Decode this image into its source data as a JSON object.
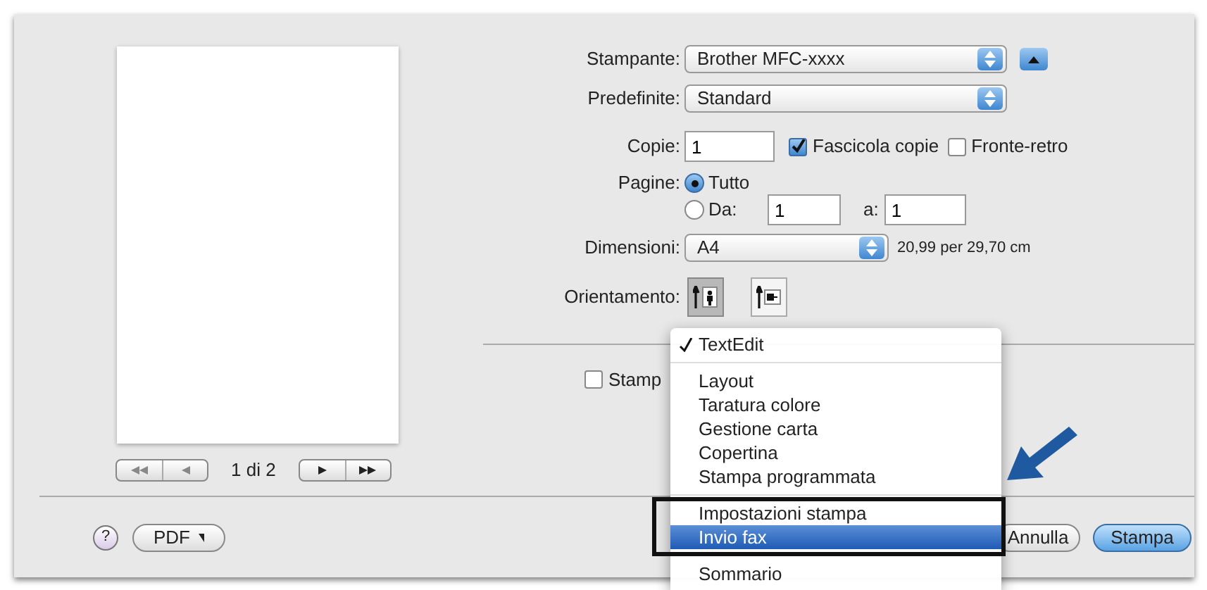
{
  "preview": {
    "page_label": "1 di 2"
  },
  "printer": {
    "label": "Stampante:",
    "value": "Brother MFC-xxxx"
  },
  "presets": {
    "label": "Predefinite:",
    "value": "Standard"
  },
  "copies": {
    "label": "Copie:",
    "value": "1"
  },
  "collate": {
    "label": "Fascicola copie",
    "checked": true
  },
  "two_sided": {
    "label": "Fronte-retro",
    "checked": false
  },
  "pages": {
    "label": "Pagine:",
    "options": [
      {
        "label": "Tutto",
        "selected": true
      },
      {
        "label": "Da:",
        "selected": false
      }
    ],
    "from": "1",
    "to_label": "a:",
    "to": "1"
  },
  "paper_size": {
    "label": "Dimensioni:",
    "value": "A4",
    "dimensions": "20,99 per 29,70 cm"
  },
  "orientation": {
    "label": "Orientamento:",
    "options": [
      {
        "kind": "portrait",
        "selected": true
      },
      {
        "kind": "landscape",
        "selected": false
      }
    ]
  },
  "header_footer": {
    "label": "Stamp",
    "checked": false
  },
  "buttons": {
    "help": "?",
    "pdf": "PDF",
    "cancel": "Annulla",
    "print": "Stampa"
  },
  "panel_menu": {
    "groups": [
      {
        "items": [
          {
            "label": "TextEdit",
            "checked": true,
            "selected": false
          }
        ]
      },
      {
        "items": [
          {
            "label": "Layout",
            "checked": false,
            "selected": false
          },
          {
            "label": "Taratura colore",
            "checked": false,
            "selected": false
          },
          {
            "label": "Gestione carta",
            "checked": false,
            "selected": false
          },
          {
            "label": "Copertina",
            "checked": false,
            "selected": false
          },
          {
            "label": "Stampa programmata",
            "checked": false,
            "selected": false
          }
        ]
      },
      {
        "items": [
          {
            "label": "Impostazioni stampa",
            "checked": false,
            "selected": false
          },
          {
            "label": "Invio fax",
            "checked": false,
            "selected": true
          }
        ]
      },
      {
        "items": [
          {
            "label": "Sommario",
            "checked": false,
            "selected": false
          }
        ]
      }
    ]
  }
}
